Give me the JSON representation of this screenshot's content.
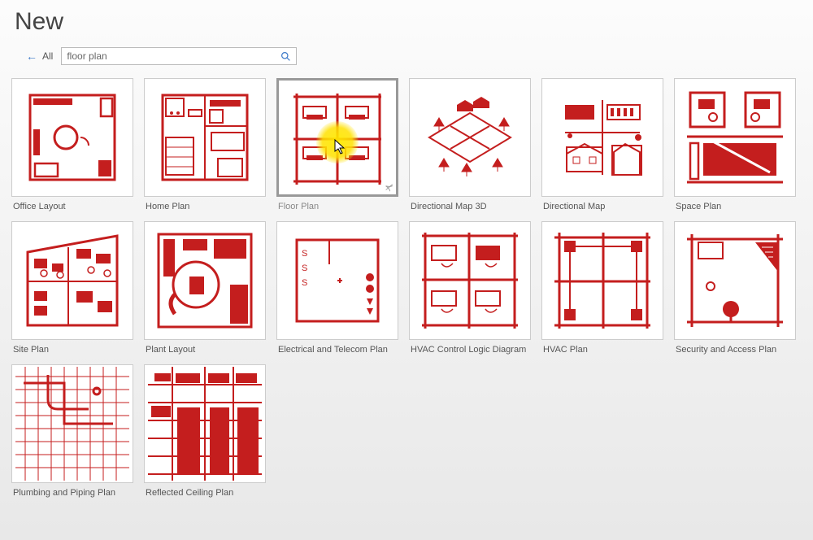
{
  "pageTitle": "New",
  "allLabel": "All",
  "search": {
    "value": "floor plan"
  },
  "backArrow": "←",
  "templates": [
    {
      "label": "Office Layout",
      "selected": false,
      "icon": "office"
    },
    {
      "label": "Home Plan",
      "selected": false,
      "icon": "home"
    },
    {
      "label": "Floor Plan",
      "selected": true,
      "icon": "floor"
    },
    {
      "label": "Directional Map 3D",
      "selected": false,
      "icon": "dirmap3d"
    },
    {
      "label": "Directional Map",
      "selected": false,
      "icon": "dirmap"
    },
    {
      "label": "Space Plan",
      "selected": false,
      "icon": "space"
    },
    {
      "label": "Site Plan",
      "selected": false,
      "icon": "site"
    },
    {
      "label": "Plant Layout",
      "selected": false,
      "icon": "plant"
    },
    {
      "label": "Electrical and Telecom Plan",
      "selected": false,
      "icon": "electrical"
    },
    {
      "label": "HVAC Control Logic Diagram",
      "selected": false,
      "icon": "hvaclogic"
    },
    {
      "label": "HVAC Plan",
      "selected": false,
      "icon": "hvac"
    },
    {
      "label": "Security and Access Plan",
      "selected": false,
      "icon": "security"
    },
    {
      "label": "Plumbing and Piping Plan",
      "selected": false,
      "icon": "plumbing"
    },
    {
      "label": "Reflected Ceiling Plan",
      "selected": false,
      "icon": "ceiling"
    }
  ]
}
